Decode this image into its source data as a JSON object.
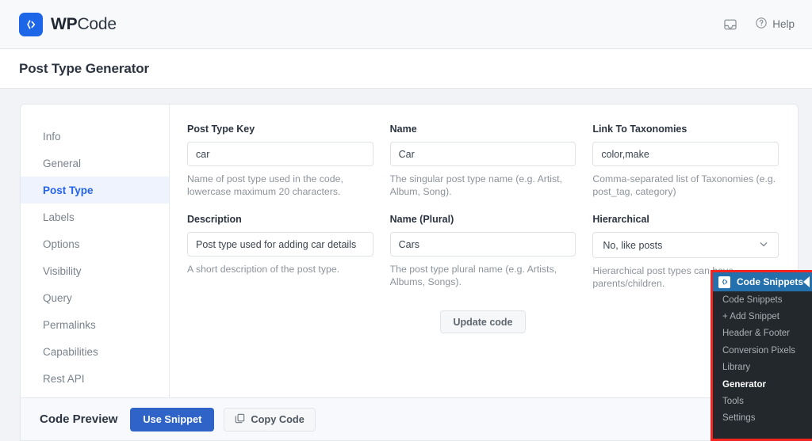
{
  "header": {
    "brand_bold": "WP",
    "brand_light": "Code",
    "brand_icon": "code-slash-icon",
    "inbox_icon": "inbox-icon",
    "help_icon": "question-circle-icon",
    "help_label": "Help"
  },
  "page": {
    "title": "Post Type Generator"
  },
  "sidebar": {
    "items": [
      {
        "label": "Info",
        "active": false
      },
      {
        "label": "General",
        "active": false
      },
      {
        "label": "Post Type",
        "active": true
      },
      {
        "label": "Labels",
        "active": false
      },
      {
        "label": "Options",
        "active": false
      },
      {
        "label": "Visibility",
        "active": false
      },
      {
        "label": "Query",
        "active": false
      },
      {
        "label": "Permalinks",
        "active": false
      },
      {
        "label": "Capabilities",
        "active": false
      },
      {
        "label": "Rest API",
        "active": false
      }
    ]
  },
  "form": {
    "post_type_key": {
      "label": "Post Type Key",
      "value": "car",
      "hint": "Name of post type used in the code, lowercase maximum 20 characters."
    },
    "name": {
      "label": "Name",
      "value": "Car",
      "hint": "The singular post type name (e.g. Artist, Album, Song)."
    },
    "link_to_taxonomies": {
      "label": "Link To Taxonomies",
      "value": "color,make",
      "hint": "Comma-separated list of Taxonomies (e.g. post_tag, category)"
    },
    "description": {
      "label": "Description",
      "value": "Post type used for adding car details",
      "hint": "A short description of the post type."
    },
    "name_plural": {
      "label": "Name (Plural)",
      "value": "Cars",
      "hint": "The post type plural name (e.g. Artists, Albums, Songs)."
    },
    "hierarchical": {
      "label": "Hierarchical",
      "value": "No, like posts",
      "hint": "Hierarchical post types can have parents/children.",
      "chevron_icon": "chevron-down-icon"
    },
    "update_button": "Update code"
  },
  "preview": {
    "title": "Code Preview",
    "use_snippet_label": "Use Snippet",
    "copy_code_label": "Copy Code",
    "copy_icon": "copy-icon"
  },
  "wp_menu": {
    "header_label": "Code Snippets",
    "header_icon": "code-slash-icon",
    "arrow_icon": "arrow-left-icon",
    "items": [
      {
        "label": "Code Snippets",
        "current": false
      },
      {
        "label": "+ Add Snippet",
        "current": false
      },
      {
        "label": "Header & Footer",
        "current": false
      },
      {
        "label": "Conversion Pixels",
        "current": false
      },
      {
        "label": "Library",
        "current": false
      },
      {
        "label": "Generator",
        "current": true
      },
      {
        "label": "Tools",
        "current": false
      },
      {
        "label": "Settings",
        "current": false
      }
    ]
  },
  "colors": {
    "brand_blue": "#1d66e8",
    "accent_blue": "#2563eb",
    "primary_button": "#2f63c7",
    "wp_menu_bg": "#23282d",
    "wp_header_blue": "#2470ad",
    "highlight_red": "#f4251e"
  }
}
